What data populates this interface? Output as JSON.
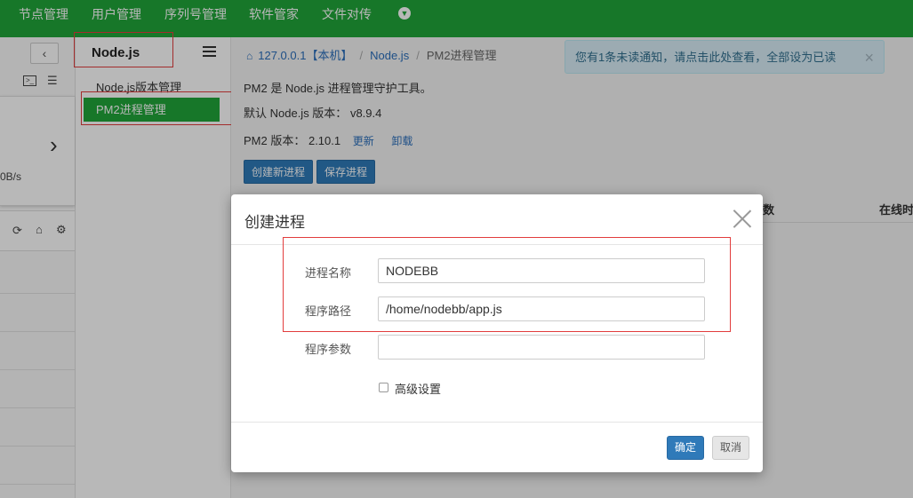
{
  "topnav": {
    "items": [
      "节点管理",
      "用户管理",
      "序列号管理",
      "软件管家",
      "文件对传"
    ]
  },
  "leftpanel": {
    "speed_text": "0B/s"
  },
  "plugin": {
    "title": "Node.js",
    "menu": [
      "Node.js版本管理",
      "PM2进程管理"
    ],
    "active_index": 1
  },
  "breadcrumb": {
    "host": "127.0.0.1",
    "host_tag": "【本机】",
    "plugin": "Node.js",
    "page": "PM2进程管理"
  },
  "content": {
    "intro": "PM2 是 Node.js 进程管理守护工具。",
    "default_node_label": "默认 Node.js 版本：",
    "default_node_version": "v8.9.4",
    "pm2_label": "PM2 版本：",
    "pm2_version": "2.10.1",
    "update_link": "更新",
    "uninstall_link": "卸载",
    "create_button": "创建新进程",
    "save_button": "保存进程",
    "table_header_partial": "数",
    "table_header_online": "在线时"
  },
  "notice": {
    "text": "您有1条未读通知，请点击此处查看，全部设为已读",
    "close": "×"
  },
  "modal": {
    "title": "创建进程",
    "fields": {
      "name_label": "进程名称",
      "name_value": "NODEBB",
      "path_label": "程序路径",
      "path_value": "/home/nodebb/app.js",
      "args_label": "程序参数",
      "args_value": ""
    },
    "advanced_label": "高级设置",
    "advanced_checked": false,
    "ok_button": "确定",
    "cancel_button": "取消"
  },
  "colors": {
    "brand_green": "#20a53a",
    "primary_blue": "#2f7ab9",
    "highlight_red": "#e23d3d"
  }
}
